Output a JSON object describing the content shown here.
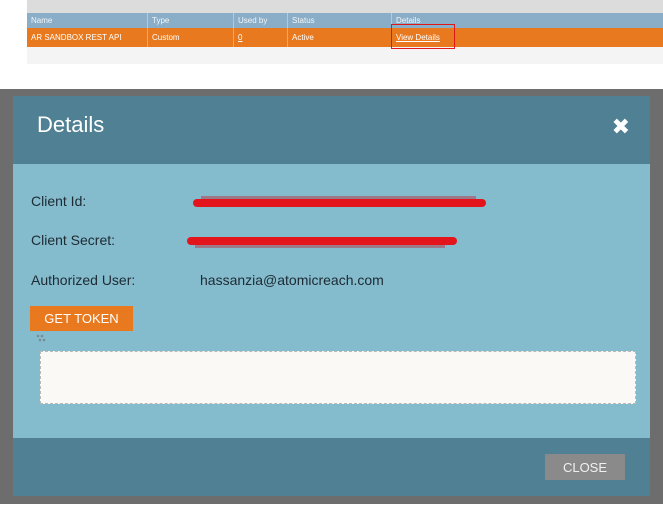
{
  "table": {
    "headers": [
      "Name",
      "Type",
      "Used by",
      "Status",
      "Details"
    ],
    "row": {
      "name": "AR SANDBOX REST API",
      "type": "Custom",
      "used_by": "0",
      "status": "Active",
      "details_link": "View Details"
    }
  },
  "modal": {
    "title": "Details",
    "close_icon": "✖",
    "client_id_label": "Client Id:",
    "client_secret_label": "Client Secret:",
    "authorized_user_label": "Authorized User:",
    "authorized_user_value": "hassanzia@atomicreach.com",
    "get_token_label": "GET TOKEN",
    "close_label": "CLOSE",
    "grip_icon": "resize-grip-icon"
  },
  "colors": {
    "orange": "#e8791e",
    "header_blue": "#4f8093",
    "body_blue": "#85bccd",
    "redaction": "#e3141b"
  }
}
